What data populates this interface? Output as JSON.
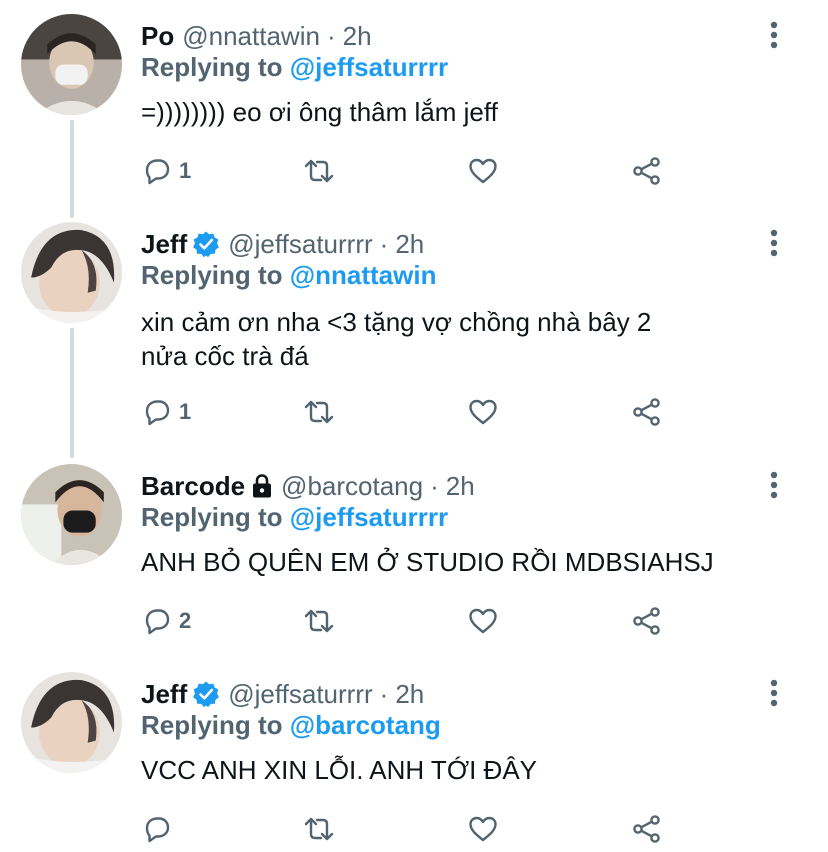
{
  "tweets": [
    {
      "name": "Po",
      "handle": "@nnattawin",
      "dot": "·",
      "time": "2h",
      "verified": false,
      "protected": false,
      "replying_prefix": "Replying to ",
      "replying_to": "@jeffsaturrrr",
      "text": "=)))))))) eo ơi ông thâm lắm jeff",
      "reply_count": "1"
    },
    {
      "name": "Jeff",
      "handle": "@jeffsaturrrr",
      "dot": "·",
      "time": "2h",
      "verified": true,
      "protected": false,
      "replying_prefix": "Replying to ",
      "replying_to": "@nnattawin",
      "text_line1": "xin cảm ơn nha <3 tặng vợ chồng nhà bây 2",
      "text_line2": "nửa cốc trà đá",
      "reply_count": "1"
    },
    {
      "name": "Barcode",
      "handle": "@barcotang",
      "dot": "·",
      "time": "2h",
      "verified": false,
      "protected": true,
      "replying_prefix": "Replying to ",
      "replying_to": "@jeffsaturrrr",
      "text": "ANH BỎ QUÊN EM Ở STUDIO RỒI MDBSIAHSJ",
      "reply_count": "2"
    },
    {
      "name": "Jeff",
      "handle": "@jeffsaturrrr",
      "dot": "·",
      "time": "2h",
      "verified": true,
      "protected": false,
      "replying_prefix": "Replying to ",
      "replying_to": "@barcotang",
      "text": "VCC ANH XIN LỖI. ANH TỚI ĐÂY",
      "reply_count": ""
    }
  ],
  "icons": {
    "reply": "reply-icon",
    "retweet": "retweet-icon",
    "like": "heart-icon",
    "share": "share-icon",
    "more": "more-vertical-icon",
    "verified": "verified-badge-icon",
    "protected": "lock-icon"
  },
  "colors": {
    "accent": "#1d9bf0",
    "secondary_text": "#536471",
    "primary_text": "#0f1419",
    "thread_line": "#cfd9de"
  }
}
